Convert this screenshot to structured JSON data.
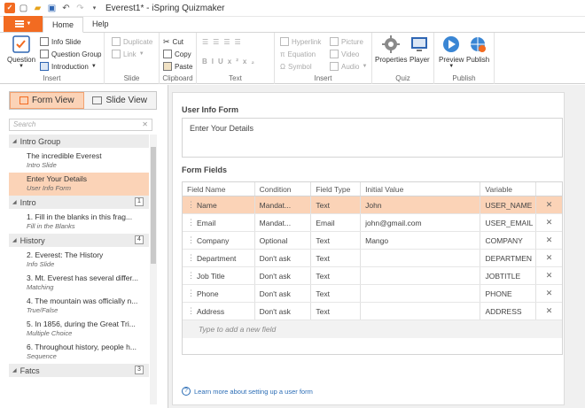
{
  "window": {
    "title": "Everest1* - iSpring Quizmaker"
  },
  "tabs": [
    {
      "label": "Home"
    },
    {
      "label": "Help"
    }
  ],
  "ribbon": {
    "insert_group": {
      "label": "Insert",
      "question": "Question",
      "info_slide": "Info Slide",
      "question_group": "Question Group",
      "introduction": "Introduction"
    },
    "slide_group": {
      "label": "Slide",
      "duplicate": "Duplicate",
      "link": "Link"
    },
    "clipboard_group": {
      "label": "Clipboard",
      "cut": "Cut",
      "copy": "Copy",
      "paste": "Paste"
    },
    "text_group": {
      "label": "Text"
    },
    "insert2_group": {
      "label": "Insert",
      "hyperlink": "Hyperlink",
      "equation": "Equation",
      "symbol": "Symbol",
      "picture": "Picture",
      "video": "Video",
      "audio": "Audio"
    },
    "quiz_group": {
      "label": "Quiz",
      "properties": "Properties",
      "player": "Player"
    },
    "publish_group": {
      "label": "Publish",
      "preview": "Preview",
      "publish": "Publish"
    }
  },
  "left": {
    "form_view": "Form View",
    "slide_view": "Slide View",
    "search_placeholder": "Search",
    "groups": [
      {
        "name": "Intro Group",
        "count": "",
        "slides": [
          {
            "title": "The incredible Everest",
            "type": "Intro Slide"
          },
          {
            "title": "Enter Your Details",
            "type": "User Info Form"
          }
        ]
      },
      {
        "name": "Intro",
        "count": "1",
        "slides": [
          {
            "title": "1. Fill in the blanks in this frag...",
            "type": "Fill in the Blanks"
          }
        ]
      },
      {
        "name": "History",
        "count": "4",
        "slides": [
          {
            "title": "2. Everest: The History",
            "type": "Info Slide"
          },
          {
            "title": "3. Mt. Everest has several differ...",
            "type": "Matching"
          },
          {
            "title": "4. The mountain was officially n...",
            "type": "True/False"
          },
          {
            "title": "5. In 1856, during the Great Tri...",
            "type": "Multiple Choice"
          },
          {
            "title": "6. Throughout history, people h...",
            "type": "Sequence"
          }
        ]
      },
      {
        "name": "Fatcs",
        "count": "3",
        "slides": []
      }
    ]
  },
  "main": {
    "form_title": "User Info Form",
    "form_text": "Enter Your Details",
    "fields_title": "Form Fields",
    "columns": [
      "Field Name",
      "Condition",
      "Field Type",
      "Initial Value",
      "Variable"
    ],
    "rows": [
      {
        "name": "Name",
        "condition": "Mandat...",
        "type": "Text",
        "initial": "John",
        "variable": "USER_NAME"
      },
      {
        "name": "Email",
        "condition": "Mandat...",
        "type": "Email",
        "initial": "john@gmail.com",
        "variable": "USER_EMAIL"
      },
      {
        "name": "Company",
        "condition": "Optional",
        "type": "Text",
        "initial": "Mango",
        "variable": "COMPANY"
      },
      {
        "name": "Department",
        "condition": "Don't ask",
        "type": "Text",
        "initial": "",
        "variable": "DEPARTMEN"
      },
      {
        "name": "Job Title",
        "condition": "Don't ask",
        "type": "Text",
        "initial": "",
        "variable": "JOBTITLE"
      },
      {
        "name": "Phone",
        "condition": "Don't ask",
        "type": "Text",
        "initial": "",
        "variable": "PHONE"
      },
      {
        "name": "Address",
        "condition": "Don't ask",
        "type": "Text",
        "initial": "",
        "variable": "ADDRESS"
      }
    ],
    "add_field_placeholder": "Type to add a new field",
    "learn_more": "Learn more about setting up a user form"
  },
  "colors": {
    "accent": "#f26b21",
    "selection": "#fbd3b7",
    "link": "#2a6cb5"
  }
}
